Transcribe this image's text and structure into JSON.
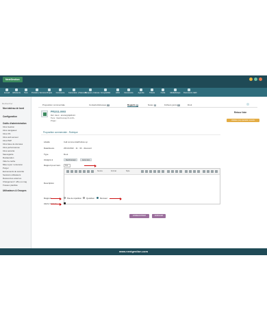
{
  "app": {
    "logo": "NextGestion",
    "user": "admin"
  },
  "menu": [
    {
      "label": "Accueil",
      "icon": "home-icon"
    },
    {
      "label": "Adhérents",
      "icon": "members-icon"
    },
    {
      "label": "Tiers",
      "icon": "thirdparty-icon"
    },
    {
      "label": "Produits | Services",
      "icon": "products-icon"
    },
    {
      "label": "Projets",
      "icon": "projects-icon"
    },
    {
      "label": "Commerce",
      "icon": "commerce-icon"
    },
    {
      "label": "Facturation | Paiement",
      "icon": "billing-icon"
    },
    {
      "label": "Banques | Caisses",
      "icon": "bank-icon"
    },
    {
      "label": "Comptabilité",
      "icon": "accounting-icon"
    },
    {
      "label": "GRH",
      "icon": "hr-icon"
    },
    {
      "label": "Documents",
      "icon": "documents-icon"
    },
    {
      "label": "Agenda",
      "icon": "agenda-icon"
    },
    {
      "label": "Tickets",
      "icon": "tickets-icon"
    },
    {
      "label": "Outils",
      "icon": "tools-icon"
    },
    {
      "label": "Médiathèque",
      "icon": "media-icon"
    },
    {
      "label": "Documents GED",
      "icon": "ged-icon"
    }
  ],
  "sidebar": {
    "search_label": "Rechercher",
    "sections": [
      {
        "title": "Mon tableau de bord",
        "links": []
      },
      {
        "title": "Configuration",
        "links": []
      },
      {
        "title": "Outils d'administration",
        "links": [
          "Infos Gestion",
          "Infos navigateur",
          "Infos OS",
          "Infos web serveur",
          "Infos PHP",
          "Infos base de données",
          "Infos performances",
          "Infos sécurité",
          "Sauvegarde",
          "Restauration",
          "Vider le cache",
          "Mise à jour / extension",
          "Purger",
          "Evènements de sécurité",
          "Sessions utilisateurs",
          "Ressources externes",
          "Changement ! offre ou mag",
          "Travaux planifiés"
        ]
      },
      {
        "title": "Utilisateurs & Groupes",
        "links": []
      }
    ]
  },
  "tabs": [
    {
      "label": "Proposition commerciale",
      "badge": ""
    },
    {
      "label": "Contacts/Adresses",
      "badge": "3"
    },
    {
      "label": "Regards",
      "badge": "2"
    },
    {
      "label": "Notes",
      "badge": "0"
    },
    {
      "label": "Fichiers joints",
      "badge": "0"
    },
    {
      "label": "Droit",
      "badge": ""
    }
  ],
  "record": {
    "ref": "PR2211-0003",
    "ref_client": "Réf. client : abcdefghijkl0123",
    "tiers": "Tiers : NextConcept S.A.R.L",
    "projet": "Projet :",
    "back_link": "Retour liste",
    "side_action": "Validate (ou) opération ouverte"
  },
  "form": {
    "section_title": "Proposition commerciale - Rubrique",
    "fields": [
      {
        "label": "Libellé",
        "value": "Call commercial/Follow up"
      },
      {
        "label": "Date/Heure",
        "value": "26/11/2022 · 11 : 30 · disonard"
      },
      {
        "label": "Type",
        "value": "Rout"
      },
      {
        "label": "Assigné à",
        "value": ""
      },
      {
        "label": "Rapport pour tiers",
        "value": "Oui"
      },
      {
        "label": "Description",
        "value": ""
      }
    ],
    "assignees": [
      "NextConcept",
      "Autre tiers"
    ],
    "toolbar_labels": {
      "source": "Source",
      "format": "Format",
      "style": "Style"
    },
    "rapport_label": "Rapport",
    "rapport_options": [
      {
        "label": "Pas de répétition",
        "selected": false
      },
      {
        "label": "Quotidien",
        "selected": false
      },
      {
        "label": "Mensuel",
        "selected": true
      }
    ],
    "notify_label": "Alerte l'auteur"
  },
  "actions": {
    "save_label": "ENREGISTRER",
    "cancel_label": "ANNULER"
  },
  "footer": {
    "text": "www.nextgestion.com"
  }
}
